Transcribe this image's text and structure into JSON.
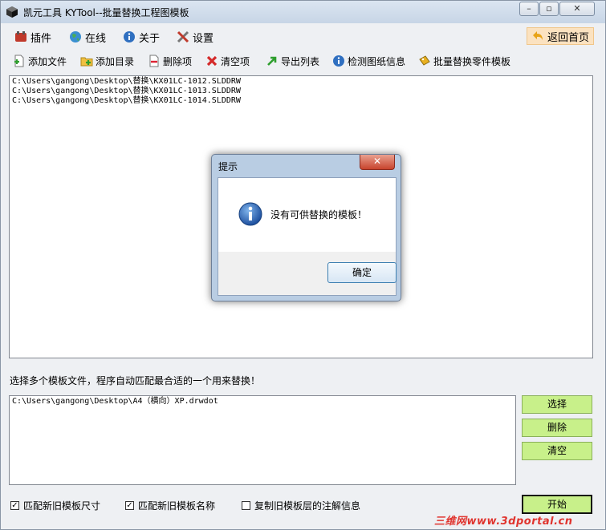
{
  "window": {
    "title": "凯元工具 KYTool--批量替换工程图模板"
  },
  "menu": [
    {
      "label": "插件",
      "icon": "plugin-icon"
    },
    {
      "label": "在线",
      "icon": "globe-icon"
    },
    {
      "label": "关于",
      "icon": "info-icon"
    },
    {
      "label": "设置",
      "icon": "tools-icon"
    }
  ],
  "back_home": {
    "label": "返回首页",
    "icon": "back-arrow-icon"
  },
  "toolbar": [
    {
      "label": "添加文件",
      "icon": "add-file-icon"
    },
    {
      "label": "添加目录",
      "icon": "add-folder-icon"
    },
    {
      "label": "删除项",
      "icon": "delete-item-icon"
    },
    {
      "label": "清空项",
      "icon": "clear-x-icon"
    },
    {
      "label": "导出列表",
      "icon": "export-arrow-icon"
    },
    {
      "label": "检测图纸信息",
      "icon": "inspect-info-icon"
    },
    {
      "label": "批量替换零件模板",
      "icon": "replace-template-icon"
    }
  ],
  "files": [
    "C:\\Users\\gangong\\Desktop\\替换\\KX01LC-1012.SLDDRW",
    "C:\\Users\\gangong\\Desktop\\替换\\KX01LC-1013.SLDDRW",
    "C:\\Users\\gangong\\Desktop\\替换\\KX01LC-1014.SLDDRW"
  ],
  "hint": "选择多个模板文件，程序自动匹配最合适的一个用来替换！",
  "templates": [
    "C:\\Users\\gangong\\Desktop\\A4（横向）XP.drwdot"
  ],
  "buttons": {
    "select": "选择",
    "delete": "删除",
    "clear": "清空",
    "start": "开始"
  },
  "options": [
    {
      "label": "匹配新旧模板尺寸",
      "checked": true
    },
    {
      "label": "匹配新旧模板名称",
      "checked": true
    },
    {
      "label": "复制旧模板层的注解信息",
      "checked": false
    }
  ],
  "dialog": {
    "title": "提示",
    "message": "没有可供替换的模板！",
    "ok": "确定"
  },
  "watermark": "三维网www.3dportal.cn"
}
